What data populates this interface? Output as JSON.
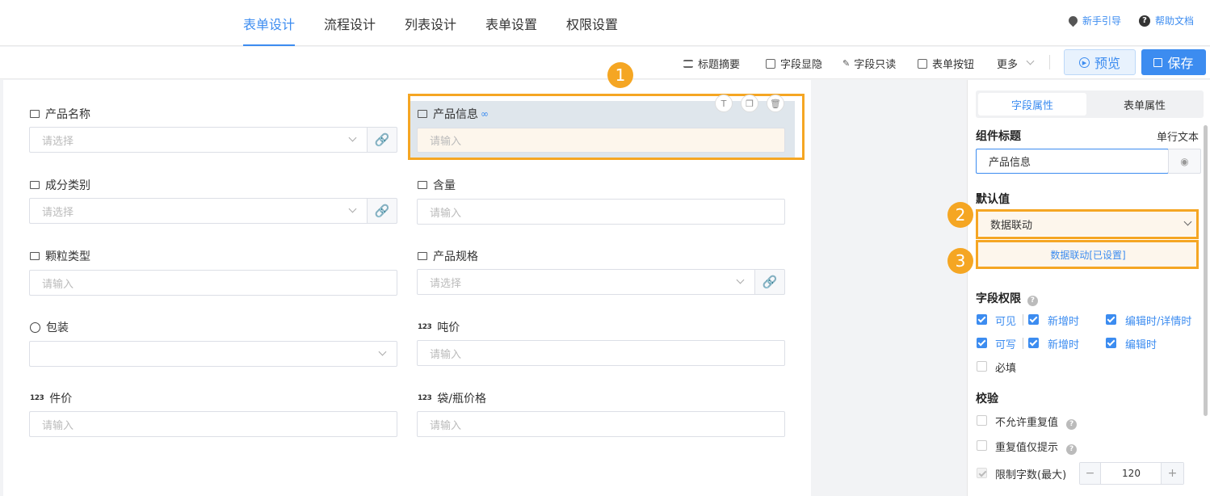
{
  "tabs": [
    {
      "label": "表单设计",
      "active": true
    },
    {
      "label": "流程设计",
      "active": false
    },
    {
      "label": "列表设计",
      "active": false
    },
    {
      "label": "表单设置",
      "active": false
    },
    {
      "label": "权限设置",
      "active": false
    }
  ],
  "help": {
    "guide": "新手引导",
    "docs": "帮助文档"
  },
  "toolbar": {
    "title_summary": "标题摘要",
    "field_visibility": "字段显隐",
    "field_readonly": "字段只读",
    "form_buttons": "表单按钮",
    "more": "更多",
    "preview": "预览",
    "save": "保存"
  },
  "fields": {
    "product_name": {
      "label": "产品名称",
      "placeholder": "请选择"
    },
    "product_info": {
      "label": "产品信息",
      "placeholder": "请输入"
    },
    "component_type": {
      "label": "成分类别",
      "placeholder": "请选择"
    },
    "content": {
      "label": "含量",
      "placeholder": "请输入"
    },
    "particle_type": {
      "label": "颗粒类型",
      "placeholder": "请输入"
    },
    "spec": {
      "label": "产品规格",
      "placeholder": "请选择"
    },
    "packaging": {
      "label": "包装",
      "placeholder": ""
    },
    "ton_price": {
      "label": "吨价",
      "placeholder": "请输入"
    },
    "unit_price": {
      "label": "件价",
      "placeholder": "请输入"
    },
    "bag_price": {
      "label": "袋/瓶价格",
      "placeholder": "请输入"
    }
  },
  "num_icon": "123",
  "badges": [
    "1",
    "2",
    "3"
  ],
  "panel": {
    "tab_field": "字段属性",
    "tab_form": "表单属性",
    "title_label": "组件标题",
    "type_text": "单行文本",
    "title_value": "产品信息",
    "default_label": "默认值",
    "default_value": "数据联动",
    "linkage_link": "数据联动[已设置]",
    "perm_label": "字段权限",
    "perm_visible": "可见",
    "perm_new1": "新增时",
    "perm_edit_detail": "编辑时/详情时",
    "perm_writable": "可写",
    "perm_new2": "新增时",
    "perm_edit": "编辑时",
    "perm_required": "必填",
    "validate_label": "校验",
    "no_dup": "不允许重复值",
    "dup_hint": "重复值仅提示",
    "limit_chars": "限制字数(最大)",
    "limit_value": "120",
    "minus": "−",
    "plus": "+",
    "q": "?"
  },
  "colors": {
    "accent": "#3c8cf0",
    "highlight": "#f5a623"
  }
}
